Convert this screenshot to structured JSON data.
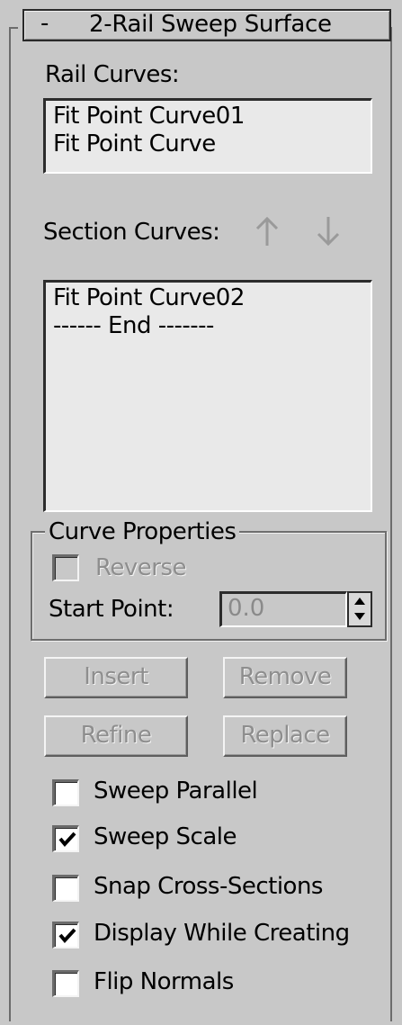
{
  "rollout": {
    "toggle": "-",
    "title": "2-Rail Sweep Surface"
  },
  "rail_curves": {
    "label": "Rail Curves:",
    "items": [
      "Fit Point Curve01",
      "Fit Point Curve"
    ]
  },
  "section_curves": {
    "label": "Section Curves:",
    "move_up_icon": "arrow-up-icon",
    "move_down_icon": "arrow-down-icon",
    "items": [
      "Fit Point Curve02",
      "------ End -------"
    ]
  },
  "curve_properties": {
    "group_title": "Curve Properties",
    "reverse_label": "Reverse",
    "reverse_checked": false,
    "reverse_enabled": false,
    "start_point_label": "Start Point:",
    "start_point_value": "0.0"
  },
  "buttons": {
    "insert": "Insert",
    "remove": "Remove",
    "refine": "Refine",
    "replace": "Replace"
  },
  "options": [
    {
      "label": "Sweep Parallel",
      "checked": false
    },
    {
      "label": "Sweep Scale",
      "checked": true
    },
    {
      "label": "Snap Cross-Sections",
      "checked": false
    },
    {
      "label": "Display While Creating",
      "checked": true
    },
    {
      "label": "Flip Normals",
      "checked": false
    }
  ],
  "colors": {
    "panel_bg": "#c8c8c8",
    "list_bg": "#e9e9e9",
    "disabled_text": "#8e8e8e",
    "arrow_gray": "#9a9a9a"
  }
}
